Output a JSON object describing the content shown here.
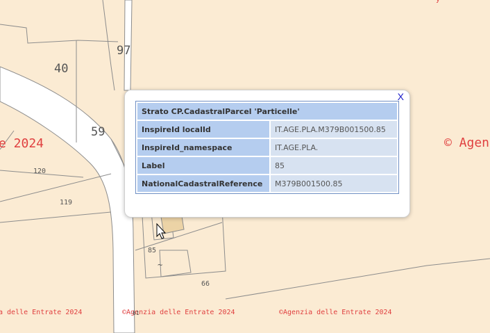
{
  "map": {
    "parcel_numbers": [
      {
        "id": "40",
        "label": "40"
      },
      {
        "id": "97",
        "label": "97"
      },
      {
        "id": "59",
        "label": "59"
      },
      {
        "id": "120",
        "label": "120"
      },
      {
        "id": "119",
        "label": "119"
      },
      {
        "id": "85",
        "label": "85"
      },
      {
        "id": "66",
        "label": "66"
      },
      {
        "id": "tilde",
        "label": "~"
      }
    ],
    "watermarks": {
      "left_large": "e 2024",
      "right_large": "© Agen",
      "bottom_1": "a delle Entrate 2024",
      "bottom_2": "©Agenzia delle Entrate 2024",
      "bottom_3": "©Agenzia delle Entrate 2024",
      "stray": "61"
    },
    "colors": {
      "background": "#fbebd3",
      "parcel_line": "#8c8c8c",
      "road_fill": "#ffffff",
      "highlight_fill": "#ecd3a6",
      "watermark": "#e04040"
    }
  },
  "popup": {
    "close_label": "X",
    "title": "Strato CP.CadastralParcel 'Particelle'",
    "rows": [
      {
        "key": "InspireId localId",
        "value": "IT.AGE.PLA.M379B001500.85"
      },
      {
        "key": "InspireId_namespace",
        "value": "IT.AGE.PLA."
      },
      {
        "key": "Label",
        "value": "85"
      },
      {
        "key": "NationalCadastralReference",
        "value": "M379B001500.85"
      }
    ]
  }
}
